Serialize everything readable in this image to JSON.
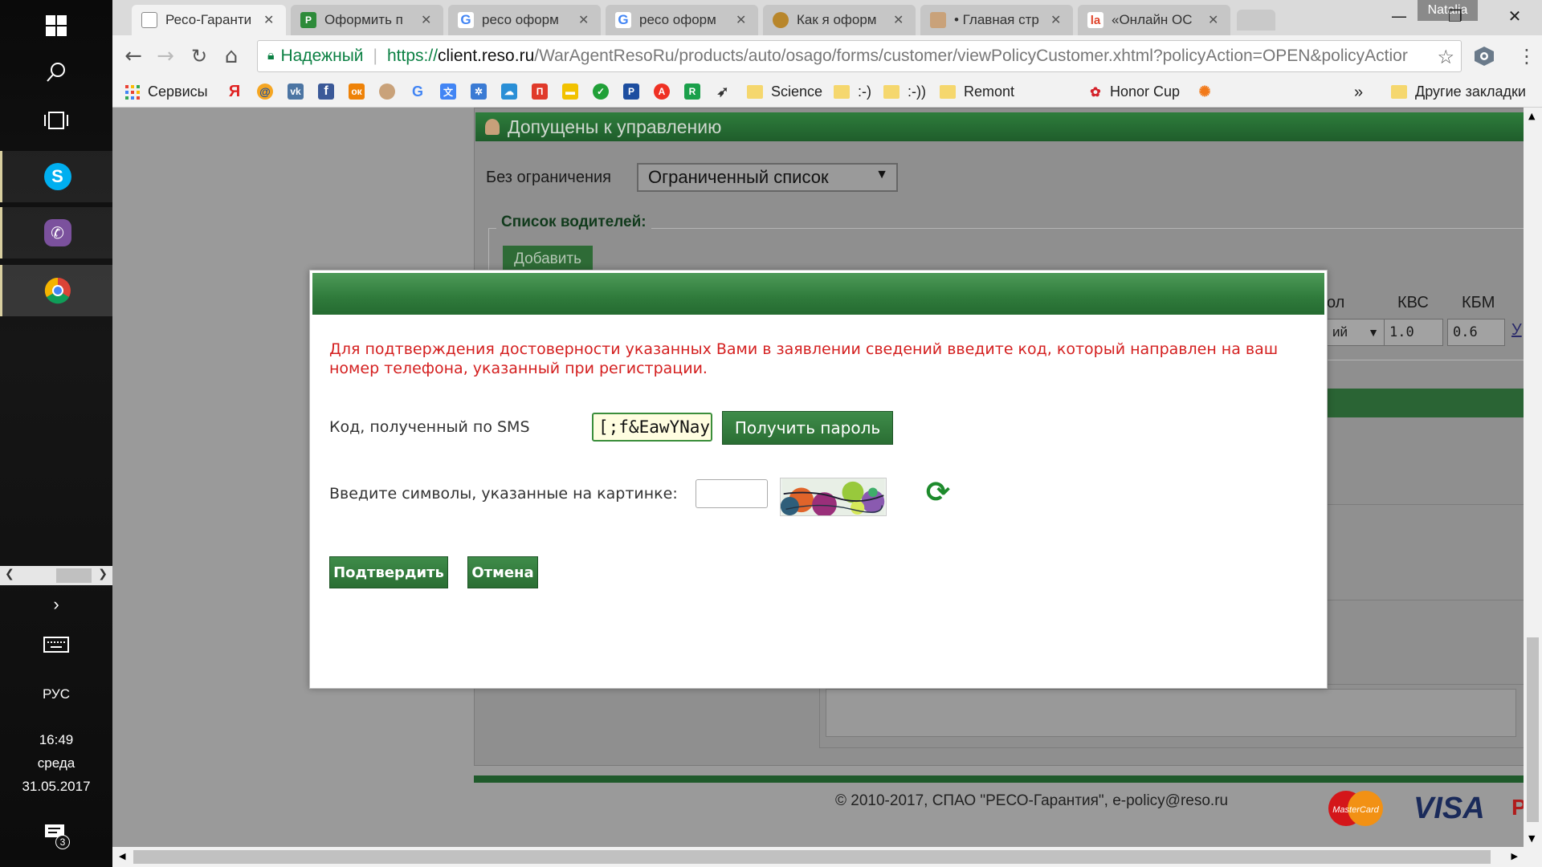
{
  "os": {
    "language": "РУС",
    "time": "16:49",
    "weekday": "среда",
    "date": "31.05.2017",
    "notification_count": "3"
  },
  "browser": {
    "user": "Natalia",
    "tabs": [
      {
        "title": "Ресо-Гаранти",
        "icon": "page-icon",
        "active": true
      },
      {
        "title": "Оформить п",
        "icon": "reso-icon"
      },
      {
        "title": "ресо оформ",
        "icon": "google-icon"
      },
      {
        "title": "ресо оформ",
        "icon": "google-icon"
      },
      {
        "title": "Как я оформ",
        "icon": "bread-icon"
      },
      {
        "title": "• Главная стр",
        "icon": "avatar-icon"
      },
      {
        "title": "«Онлайн ОС",
        "icon": "la-icon"
      }
    ],
    "omnibox": {
      "secure_label": "Надежный",
      "protocol": "https://",
      "host": "client.reso.ru",
      "path": "/WarAgentResoRu/products/auto/osago/forms/customer/viewPolicyCustomer.xhtml?policyAction=OPEN&policyActior"
    },
    "bookmarks": {
      "apps_label": "Сервисы",
      "folders": [
        "Science",
        ":-)",
        ":-))",
        "Remont"
      ],
      "honor_label": "Honor Cup",
      "more": "»",
      "other_label": "Другие закладки"
    }
  },
  "page": {
    "section_title": "Допущены к управлению",
    "restriction_label": "Без ограничения",
    "restriction_value": "Ограниченный список",
    "drivers_legend": "Список водителей:",
    "add_button": "Добавить",
    "columns": {
      "partial": "ол",
      "kvs": "КВС",
      "kbm": "КБМ",
      "edge": "У"
    },
    "row": {
      "partial_select": "ий",
      "kvs": "1.0",
      "kbm": "0.6"
    },
    "footer": "© 2010-2017, СПАО \"РЕСО-Гарантия\", e-policy@reso.ru",
    "payment": {
      "mastercard": "MasterCard",
      "visa": "VISA",
      "edge": "P"
    }
  },
  "modal": {
    "message": "Для подтверждения достоверности указанных Вами в заявлении сведений введите код, который направлен на ваш номер телефона, указанный при регистрации.",
    "sms_label": "Код, полученный по SMS",
    "sms_value": "[;f&EawYNay",
    "get_password": "Получить пароль",
    "captcha_label": "Введите символы, указанные на картинке:",
    "confirm": "Подтвердить",
    "cancel": "Отмена"
  },
  "colors": {
    "accent_green": "#2f7a3b",
    "error_red": "#d41f1f"
  }
}
